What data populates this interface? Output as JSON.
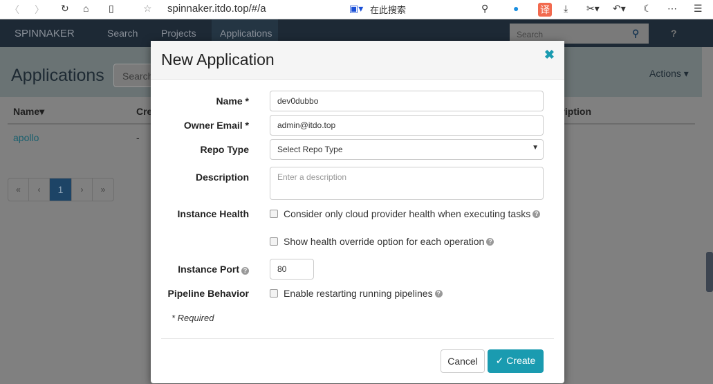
{
  "browser": {
    "url": "spinnaker.itdo.top/#/a",
    "search_placeholder": "在此搜索",
    "translate": "译"
  },
  "nav": {
    "brand": "SPINNAKER",
    "items": [
      "Search",
      "Projects",
      "Applications"
    ],
    "active": "Applications",
    "search_placeholder": "Search",
    "help": "?"
  },
  "page": {
    "title": "Applications",
    "search_placeholder": "Search",
    "actions": "Actions ▾",
    "columns": [
      "Name▾",
      "Created",
      "Description"
    ],
    "rows": [
      {
        "name": "apollo",
        "created": "-"
      }
    ],
    "pagination": [
      "«",
      "‹",
      "1",
      "›",
      "»"
    ],
    "current_page": 1
  },
  "modal": {
    "title": "New Application",
    "close": "✖",
    "fields": {
      "name_label": "Name *",
      "name_value": "dev0dubbo",
      "email_label": "Owner Email *",
      "email_value": "admin@itdo.top",
      "repo_label": "Repo Type",
      "repo_value": "Select Repo Type",
      "desc_label": "Description",
      "desc_placeholder": "Enter a description",
      "health_label": "Instance Health",
      "health_opt1": "Consider only cloud provider health when executing tasks",
      "health_opt2": "Show health override option for each operation",
      "port_label": "Instance Port",
      "port_value": "80",
      "pipeline_label": "Pipeline Behavior",
      "pipeline_opt": "Enable restarting running pipelines"
    },
    "required_note": "* Required",
    "cancel": "Cancel",
    "create": "Create"
  },
  "colors": {
    "accent": "#1a9bb0",
    "navbar": "#1d2935"
  }
}
